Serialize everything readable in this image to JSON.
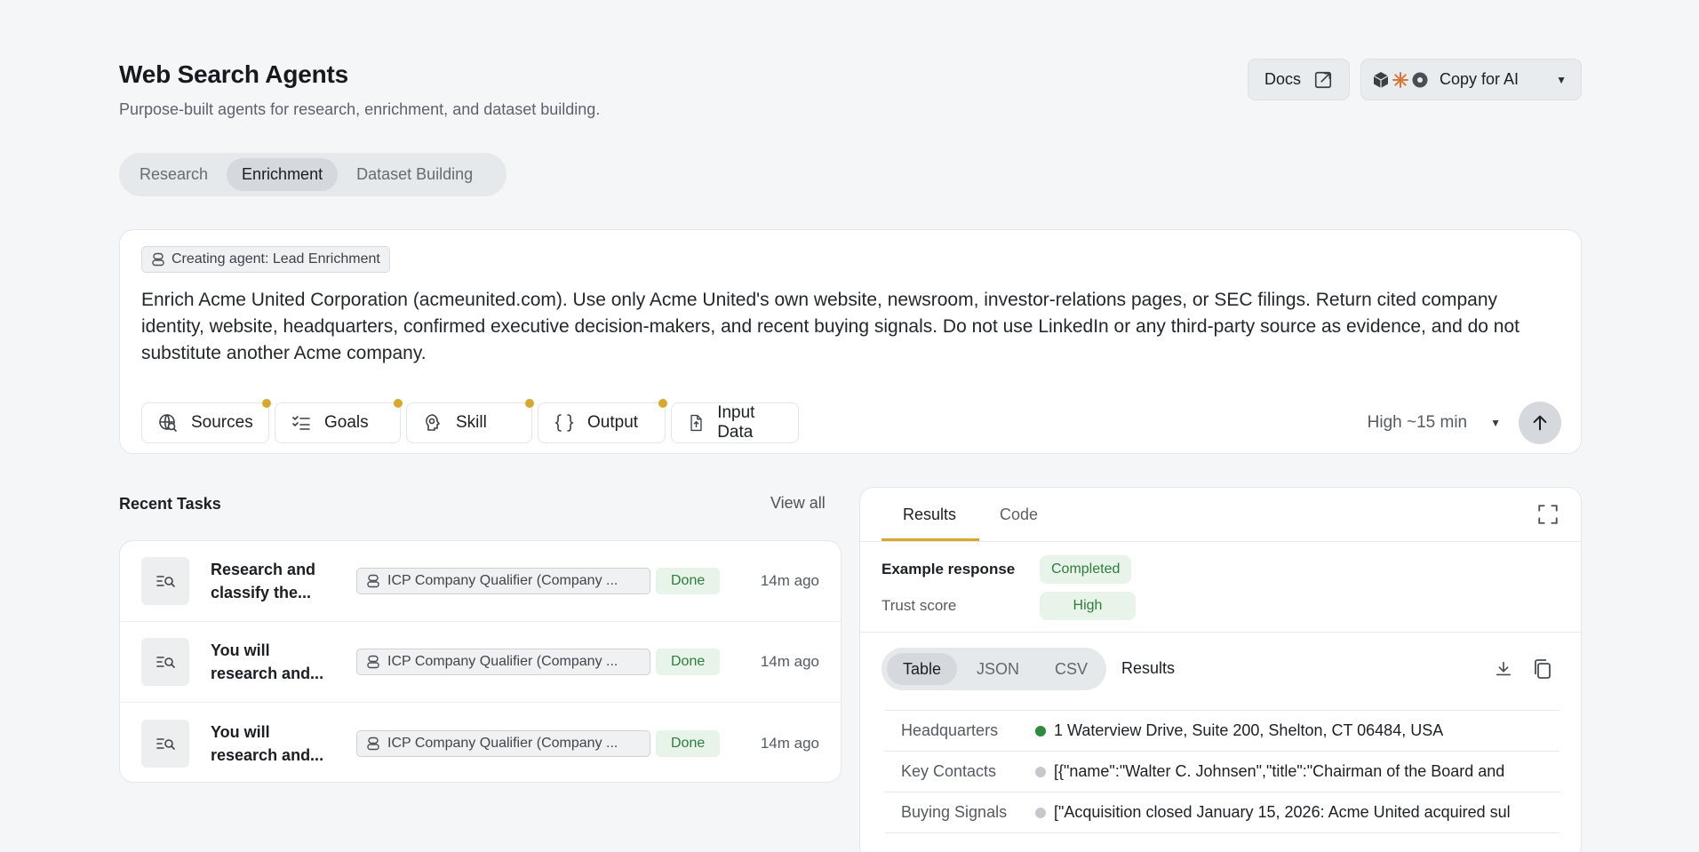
{
  "header": {
    "title": "Web Search Agents",
    "subtitle": "Purpose-built agents for research, enrichment, and dataset building.",
    "docs_label": "Docs",
    "copy_label": "Copy for AI"
  },
  "mode_tabs": [
    {
      "label": "Research",
      "active": false
    },
    {
      "label": "Enrichment",
      "active": true
    },
    {
      "label": "Dataset Building",
      "active": false
    }
  ],
  "composer": {
    "agent_chip": "Creating agent: Lead Enrichment",
    "prompt": "Enrich Acme United Corporation (acmeunited.com). Use only Acme United's own website, newsroom, investor-relations pages, or SEC filings. Return cited company identity, website, headquarters, confirmed executive decision-makers, and recent buying signals. Do not use LinkedIn or any third-party source as evidence, and do not substitute another Acme company.",
    "tools": [
      {
        "label": "Sources",
        "icon": "globe-search-icon",
        "has_dot": true
      },
      {
        "label": "Goals",
        "icon": "checklist-icon",
        "has_dot": true
      },
      {
        "label": "Skill",
        "icon": "brain-icon",
        "has_dot": true
      },
      {
        "label": "Output",
        "icon": "braces-icon",
        "has_dot": true
      },
      {
        "label": "Input Data",
        "icon": "file-upload-icon",
        "has_dot": false
      }
    ],
    "effort": "High ~15 min"
  },
  "recent": {
    "title": "Recent Tasks",
    "view_all": "View all",
    "tasks": [
      {
        "name": "Research and classify the...",
        "agent": "ICP Company Qualifier (Company ...",
        "status": "Done",
        "time": "14m ago"
      },
      {
        "name": "You will research and...",
        "agent": "ICP Company Qualifier (Company ...",
        "status": "Done",
        "time": "14m ago"
      },
      {
        "name": "You will research and...",
        "agent": "ICP Company Qualifier (Company ...",
        "status": "Done",
        "time": "14m ago"
      }
    ]
  },
  "results": {
    "tabs": [
      {
        "label": "Results",
        "active": true
      },
      {
        "label": "Code",
        "active": false
      }
    ],
    "example_label": "Example response",
    "example_status": "Completed",
    "trust_label": "Trust score",
    "trust_value": "High",
    "formats": [
      {
        "label": "Table",
        "active": true
      },
      {
        "label": "JSON",
        "active": false
      },
      {
        "label": "CSV",
        "active": false
      }
    ],
    "format_title": "Results",
    "rows": [
      {
        "key": "Headquarters",
        "value": "1 Waterview Drive, Suite 200, Shelton, CT 06484, USA",
        "dot": "#2e8b3e"
      },
      {
        "key": "Key Contacts",
        "value": "[{\"name\":\"Walter C. Johnsen\",\"title\":\"Chairman of the Board and",
        "dot": "#c5c8cc"
      },
      {
        "key": "Buying Signals",
        "value": "[\"Acquisition closed January 15, 2026: Acme United acquired sul",
        "dot": "#c5c8cc"
      }
    ]
  },
  "colors": {
    "accent": "#d9a72a",
    "done_bg": "#e8f3ea",
    "done_text": "#2e7d3c"
  }
}
